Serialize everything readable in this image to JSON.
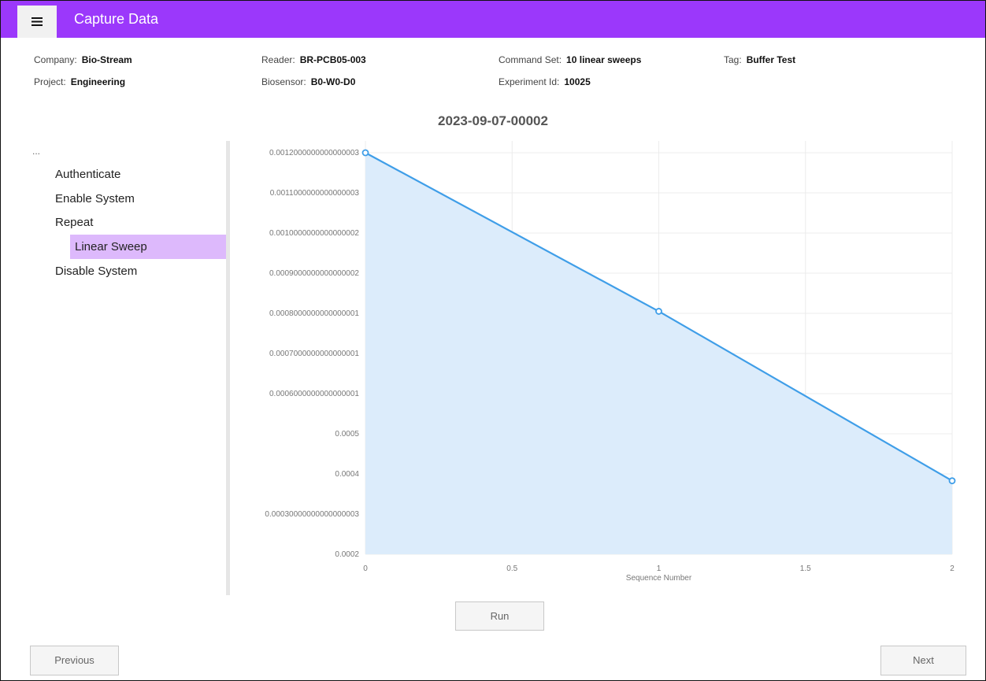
{
  "header": {
    "title": "Capture Data",
    "menu_icon": "hamburger-menu-icon",
    "bar_color": "#9b38fb"
  },
  "info": {
    "company": {
      "label": "Company:",
      "value": "Bio-Stream"
    },
    "project": {
      "label": "Project:",
      "value": "Engineering"
    },
    "reader": {
      "label": "Reader:",
      "value": "BR-PCB05-003"
    },
    "biosensor": {
      "label": "Biosensor:",
      "value": "B0-W0-D0"
    },
    "command_set": {
      "label": "Command Set:",
      "value": "10 linear sweeps"
    },
    "experiment_id": {
      "label": "Experiment Id:",
      "value": "10025"
    },
    "tag": {
      "label": "Tag:",
      "value": "Buffer Test"
    }
  },
  "run_id": "2023-09-07-00002",
  "steps": {
    "ellipsis": "...",
    "items": [
      {
        "label": "Authenticate",
        "level": 0,
        "selected": false
      },
      {
        "label": "Enable System",
        "level": 0,
        "selected": false
      },
      {
        "label": "Repeat",
        "level": 0,
        "selected": false
      },
      {
        "label": "Linear Sweep",
        "level": 1,
        "selected": true
      },
      {
        "label": "Disable System",
        "level": 0,
        "selected": false
      }
    ],
    "selected_color": "#ddb9fc"
  },
  "chart_data": {
    "type": "area",
    "title": "",
    "xlabel": "Sequence Number",
    "ylabel": "",
    "x": [
      0,
      1,
      2
    ],
    "series": [
      {
        "values": [
          0.0012,
          0.000805,
          0.000383
        ],
        "color": "#3f9ee8",
        "fill": "#dcecfb"
      }
    ],
    "xlim": [
      0,
      2
    ],
    "ylim": [
      0.0002,
      0.0012
    ],
    "x_ticks": [
      "0",
      "0.5",
      "1",
      "1.5",
      "2"
    ],
    "y_ticks": [
      "0.0002",
      "0.00030000000000000003",
      "0.0004",
      "0.0005",
      "0.0006000000000000001",
      "0.0007000000000000001",
      "0.0008000000000000001",
      "0.0009000000000000002",
      "0.0010000000000000002",
      "0.0011000000000000003",
      "0.0012000000000000003"
    ],
    "grid": true
  },
  "buttons": {
    "run": "Run",
    "previous": "Previous",
    "next": "Next"
  }
}
